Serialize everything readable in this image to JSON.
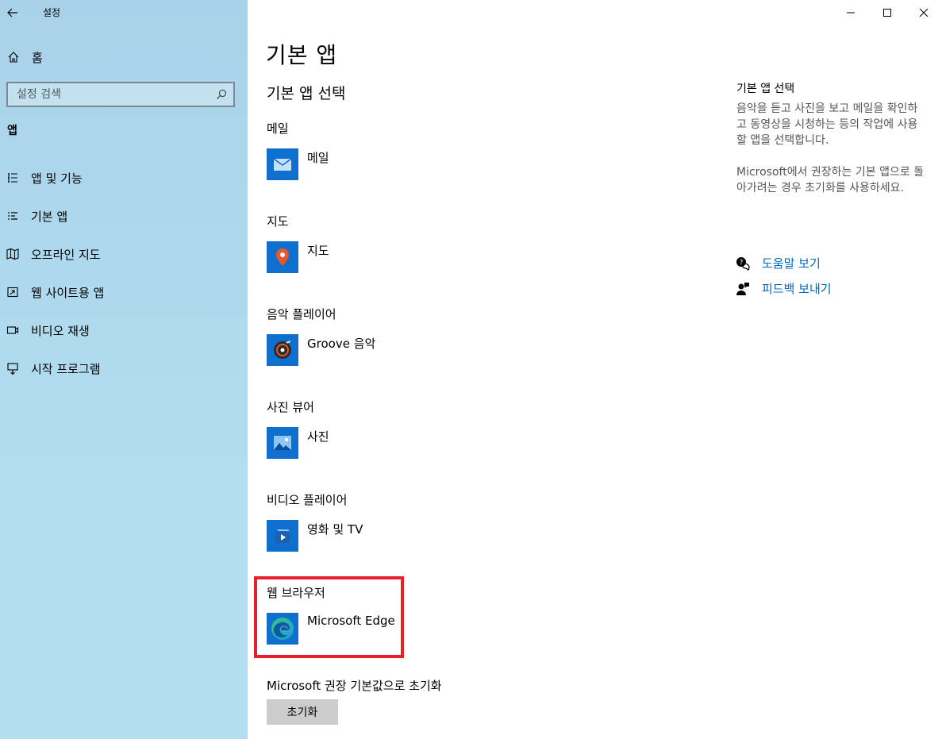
{
  "window": {
    "app_title": "설정",
    "controls": [
      "minimize-icon",
      "maximize-icon",
      "close-icon"
    ]
  },
  "sidebar": {
    "home_label": "홈",
    "search_placeholder": "설정 검색",
    "section_label": "앱",
    "items": [
      {
        "label": "앱 및 기능",
        "icon": "list-icon"
      },
      {
        "label": "기본 앱",
        "icon": "default-apps-icon"
      },
      {
        "label": "오프라인 지도",
        "icon": "map-icon"
      },
      {
        "label": "웹 사이트용 앱",
        "icon": "web-app-icon"
      },
      {
        "label": "비디오 재생",
        "icon": "video-icon"
      },
      {
        "label": "시작 프로그램",
        "icon": "startup-icon"
      }
    ]
  },
  "main": {
    "title": "기본 앱",
    "subtitle": "기본 앱 선택",
    "categories": [
      {
        "label": "메일",
        "app": "메일",
        "icon": "mail-icon"
      },
      {
        "label": "지도",
        "app": "지도",
        "icon": "maps-pin-icon"
      },
      {
        "label": "음악 플레이어",
        "app": "Groove 음악",
        "icon": "groove-music-icon"
      },
      {
        "label": "사진 뷰어",
        "app": "사진",
        "icon": "photos-icon"
      },
      {
        "label": "비디오 플레이어",
        "app": "영화 및 TV",
        "icon": "movies-tv-icon"
      },
      {
        "label": "웹 브라우저",
        "app": "Microsoft Edge",
        "icon": "edge-icon"
      }
    ],
    "reset_label": "Microsoft 권장 기본값으로 초기화",
    "reset_button": "초기화"
  },
  "right_panel": {
    "title": "기본 앱 선택",
    "desc1": "음악을 듣고 사진을 보고 메일을 확인하고 동영상을 시청하는 등의 작업에 사용할 앱을 선택합니다.",
    "desc2": "Microsoft에서 권장하는 기본 앱으로 돌아가려는 경우 초기화를 사용하세요.",
    "links": [
      {
        "label": "도움말 보기",
        "icon": "help-icon"
      },
      {
        "label": "피드백 보내기",
        "icon": "feedback-icon"
      }
    ]
  },
  "colors": {
    "accent": "#0067c0",
    "tile": "#0f6fcf",
    "highlight": "#e8202a"
  }
}
